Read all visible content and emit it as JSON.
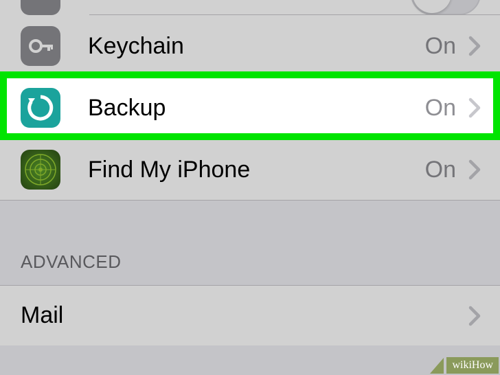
{
  "rows": [
    {
      "type": "toggle_partial"
    },
    {
      "label": "Keychain",
      "status": "On",
      "icon": "key",
      "iconBg": "#8e8e93"
    },
    {
      "label": "Backup",
      "status": "On",
      "icon": "backup",
      "iconBg": "#1ba39c",
      "highlighted": true
    },
    {
      "label": "Find My iPhone",
      "status": "On",
      "icon": "radar",
      "iconBg": "#3a3a3a"
    }
  ],
  "sectionHeader": "ADVANCED",
  "mail": {
    "label": "Mail"
  },
  "watermark": "wikiHow",
  "colors": {
    "highlight": "#00e400",
    "statusText": "#8e8e93",
    "chevron": "#c7c7cc",
    "bg": "#efeff4"
  }
}
